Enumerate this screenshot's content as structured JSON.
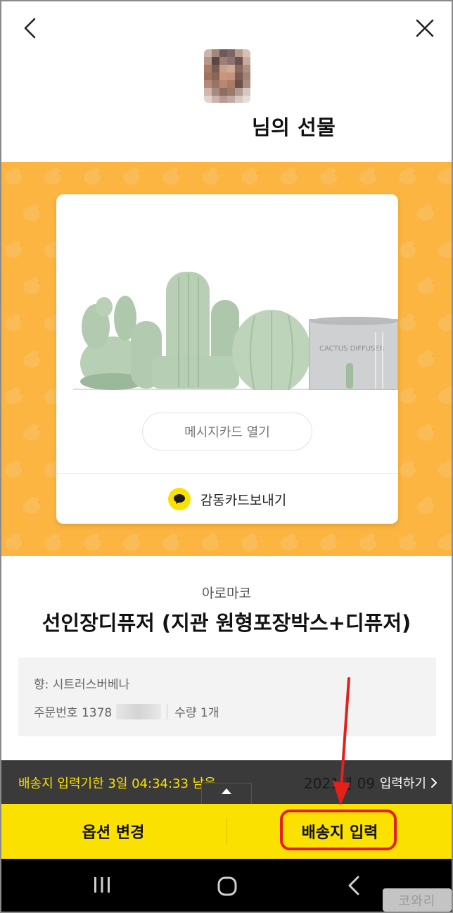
{
  "header": {
    "title": "님의 선물",
    "back_icon": "chevron-left-icon",
    "close_icon": "close-icon"
  },
  "card": {
    "message_card_label": "메시지카드 열기",
    "thanks_card_label": "감동카드보내기",
    "thanks_icon": "chat-bubble-icon",
    "product_photo_text": "CACTUS DIFFUSER"
  },
  "product": {
    "brand": "아로마코",
    "name": "선인장디퓨저 (지관 원형포장박스+디퓨저)",
    "option_scent": "향: 시트러스버베나",
    "order_number_label": "주문번호 1378",
    "quantity": "수량 1개"
  },
  "deadline_bar": {
    "text": "배송지 입력기한 3일 04:34:33 남음",
    "date_partial": "2021년 09",
    "input_link": "입력하기",
    "input_link_icon": "chevron-right-icon"
  },
  "action_bar": {
    "option_change": "옵션 변경",
    "address_input": "배송지 입력"
  },
  "colors": {
    "banner": "#fdb541",
    "accent_yellow": "#fae100",
    "highlight_red": "#e3201b",
    "dark_bar": "#3a3a3a"
  },
  "watermark": {
    "text": "코와리"
  }
}
